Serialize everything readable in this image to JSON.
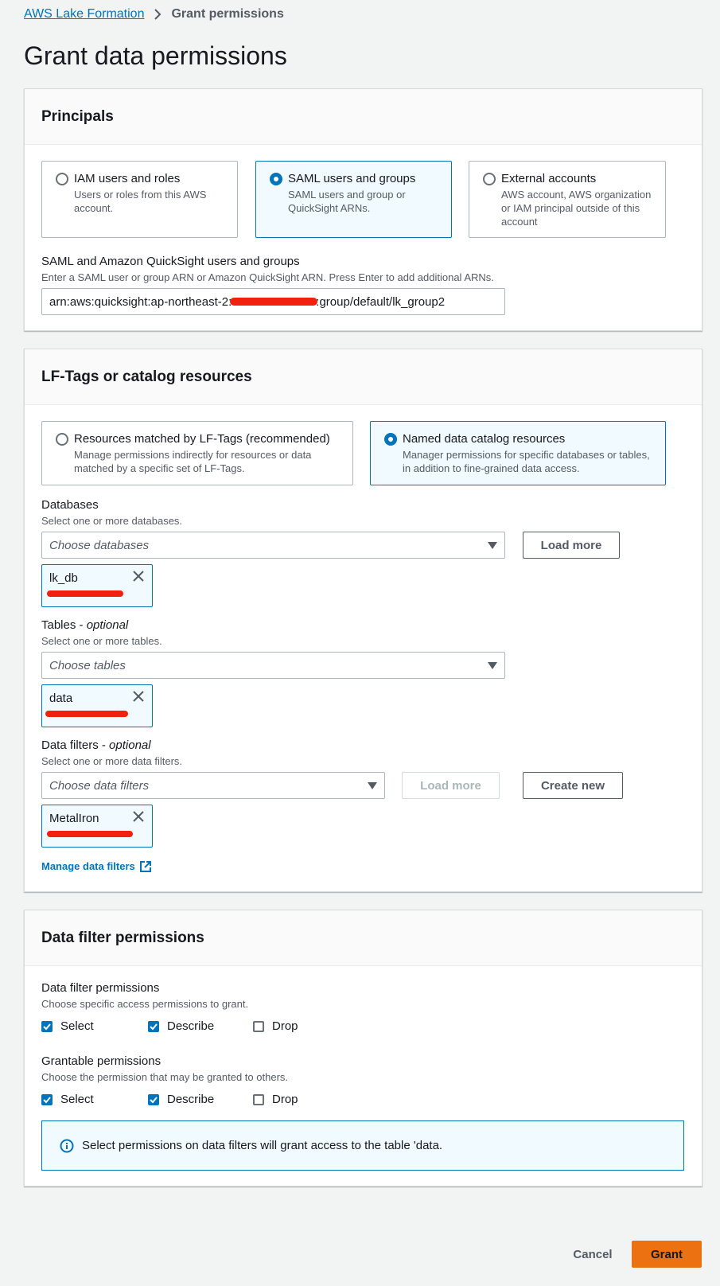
{
  "breadcrumb": {
    "root": "AWS Lake Formation",
    "current": "Grant permissions"
  },
  "page_title": "Grant data permissions",
  "principals": {
    "title": "Principals",
    "options": [
      {
        "title": "IAM users and roles",
        "desc": "Users or roles from this AWS account."
      },
      {
        "title": "SAML users and groups",
        "desc": "SAML users and group or QuickSight ARNs."
      },
      {
        "title": "External accounts",
        "desc": "AWS account, AWS organization or IAM principal outside of this account"
      }
    ],
    "selected_index": 1,
    "field_label": "SAML and Amazon QuickSight users and groups",
    "field_hint": "Enter a SAML user or group ARN or Amazon QuickSight ARN. Press Enter to add additional ARNs.",
    "field_value_prefix": "arn:aws:quicksight:ap-northeast-2:",
    "field_value_suffix": ":group/default/lk_group2"
  },
  "resources": {
    "title": "LF-Tags or catalog resources",
    "options": [
      {
        "title": "Resources matched by LF-Tags (recommended)",
        "desc": "Manage permissions indirectly for resources or data matched by a specific set of LF-Tags."
      },
      {
        "title": "Named data catalog resources",
        "desc": "Manager permissions for specific databases or tables, in addition to fine-grained data access."
      }
    ],
    "selected_index": 1,
    "databases": {
      "label": "Databases",
      "hint": "Select one or more databases.",
      "placeholder": "Choose databases",
      "load_more": "Load more",
      "token": "lk_db"
    },
    "tables": {
      "label": "Tables",
      "optional": "optional",
      "hint": "Select one or more tables.",
      "placeholder": "Choose tables",
      "token": "data"
    },
    "data_filters": {
      "label": "Data filters",
      "optional": "optional",
      "hint": "Select one or more data filters.",
      "placeholder": "Choose data filters",
      "load_more": "Load more",
      "create_new": "Create new",
      "token": "MetalIron"
    },
    "manage_link": "Manage data filters"
  },
  "filter_permissions": {
    "title": "Data filter permissions",
    "perm_label": "Data filter permissions",
    "perm_hint": "Choose specific access permissions to grant.",
    "perms": [
      {
        "label": "Select",
        "checked": true
      },
      {
        "label": "Describe",
        "checked": true
      },
      {
        "label": "Drop",
        "checked": false
      }
    ],
    "grantable_label": "Grantable permissions",
    "grantable_hint": "Choose the permission that may be granted to others.",
    "grantable": [
      {
        "label": "Select",
        "checked": true
      },
      {
        "label": "Describe",
        "checked": true
      },
      {
        "label": "Drop",
        "checked": false
      }
    ],
    "info": "Select permissions on data filters will grant access to the table 'data."
  },
  "footer": {
    "cancel": "Cancel",
    "grant": "Grant"
  },
  "colors": {
    "accent": "#0073bb",
    "primary_button": "#ec7211",
    "redaction": "#f2200f"
  }
}
